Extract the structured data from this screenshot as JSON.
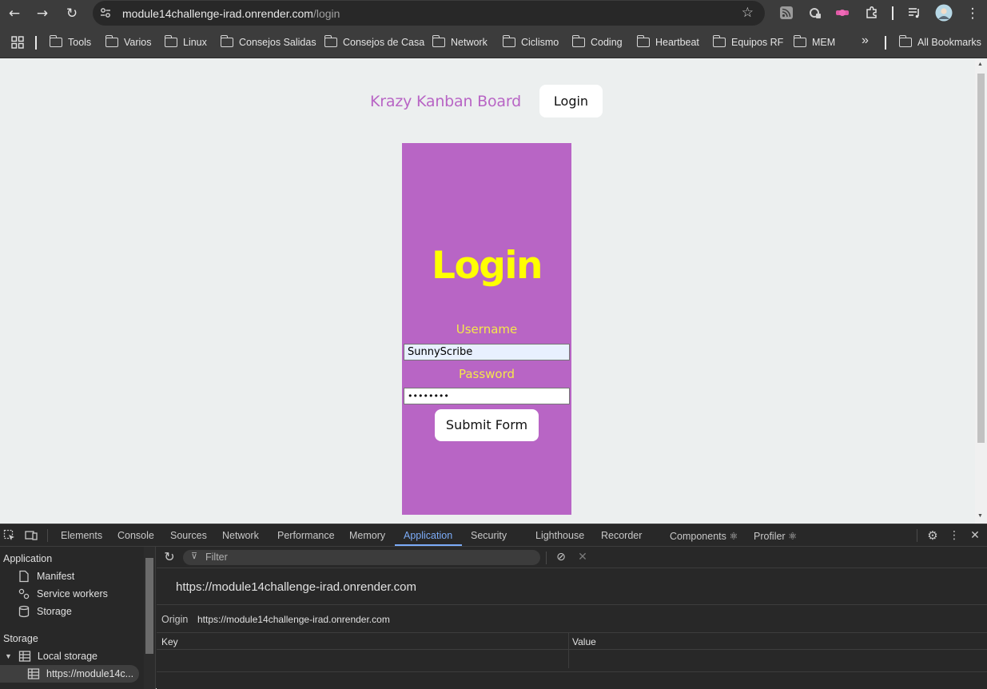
{
  "browser": {
    "url_host": "module14challenge-irad.onrender.com",
    "url_path": "/login",
    "bookmarks": [
      "Tools",
      "Varios",
      "Linux",
      "Consejos Salidas",
      "Consejos de Casa",
      "Network",
      "Ciclismo",
      "Coding",
      "Heartbeat",
      "Equipos RF",
      "MEM"
    ],
    "overflow_label": "»",
    "all_bookmarks": "All Bookmarks"
  },
  "page": {
    "brand": "Krazy Kanban Board",
    "nav_login": "Login",
    "form": {
      "title": "Login",
      "username_label": "Username",
      "username_value": "SunnyScribe",
      "password_label": "Password",
      "password_value": "••••••••",
      "submit_label": "Submit Form"
    },
    "colors": {
      "card": "#b865c5",
      "title": "#ffff00",
      "labels": "#f5e84a",
      "background": "#ecefef"
    }
  },
  "devtools": {
    "tabs": [
      "Elements",
      "Console",
      "Sources",
      "Network",
      "Performance",
      "Memory",
      "Application",
      "Security",
      "Lighthouse",
      "Recorder",
      "Components ⚛",
      "Profiler ⚛"
    ],
    "active_tab": "Application",
    "sidebar": {
      "application_heading": "Application",
      "items": [
        "Manifest",
        "Service workers",
        "Storage"
      ],
      "storage_heading": "Storage",
      "local_storage": "Local storage",
      "local_storage_origin": "https://module14c..."
    },
    "filter_placeholder": "Filter",
    "origin_title": "https://module14challenge-irad.onrender.com",
    "origin_label": "Origin",
    "origin_value": "https://module14challenge-irad.onrender.com",
    "table": {
      "key_header": "Key",
      "value_header": "Value"
    }
  }
}
